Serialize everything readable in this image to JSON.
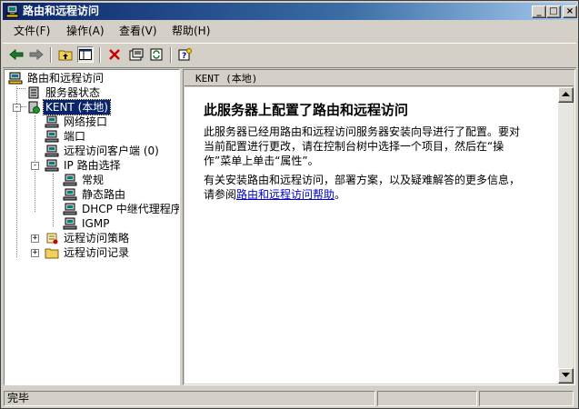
{
  "window": {
    "title": "路由和远程访问",
    "controls": {
      "minimize": "_",
      "maximize": "□",
      "close": "×"
    }
  },
  "menu": [
    {
      "label": "文件(F)"
    },
    {
      "label": "操作(A)"
    },
    {
      "label": "查看(V)"
    },
    {
      "label": "帮助(H)"
    }
  ],
  "toolbar": {
    "icons": [
      "back-arrow-icon",
      "forward-arrow-icon",
      "up-folder-icon",
      "show-hide-tree-icon",
      "delete-x-icon",
      "properties-icon",
      "refresh-icon",
      "help-icon"
    ]
  },
  "tree": {
    "root": "路由和远程访问",
    "server_status": "服务器状态",
    "server": "KENT (本地)",
    "network_interfaces": "网络接口",
    "ports": "端口",
    "remote_clients": "远程访问客户端 (0)",
    "ip_routing": "IP 路由选择",
    "general": "常规",
    "static_routes": "静态路由",
    "dhcp_relay": "DHCP 中继代理程序",
    "igmp": "IGMP",
    "remote_policies": "远程访问策略",
    "remote_logging": "远程访问记录"
  },
  "details": {
    "header": "KENT (本地)",
    "heading": "此服务器上配置了路由和远程访问",
    "para1_lines": [
      "此服务器已经用路由和远程访问服务器安装向导进行了配置。要对",
      "当前配置进行更改，请在控制台树中选择一个项目，然后在“操",
      "作”菜单上单击“属性”。"
    ],
    "para2_line1": "有关安装路由和远程访问，部署方案，以及疑难解答的更多信息，",
    "para2_prefix": "请参阅",
    "help_link": "路由和远程访问帮助",
    "para2_suffix": "。"
  },
  "status": {
    "text": "完毕"
  },
  "colors": {
    "title_start": "#0a246a",
    "title_end": "#a6caf0",
    "selection": "#0a246a",
    "link": "#0000cc",
    "delete_red": "#cc0000"
  }
}
